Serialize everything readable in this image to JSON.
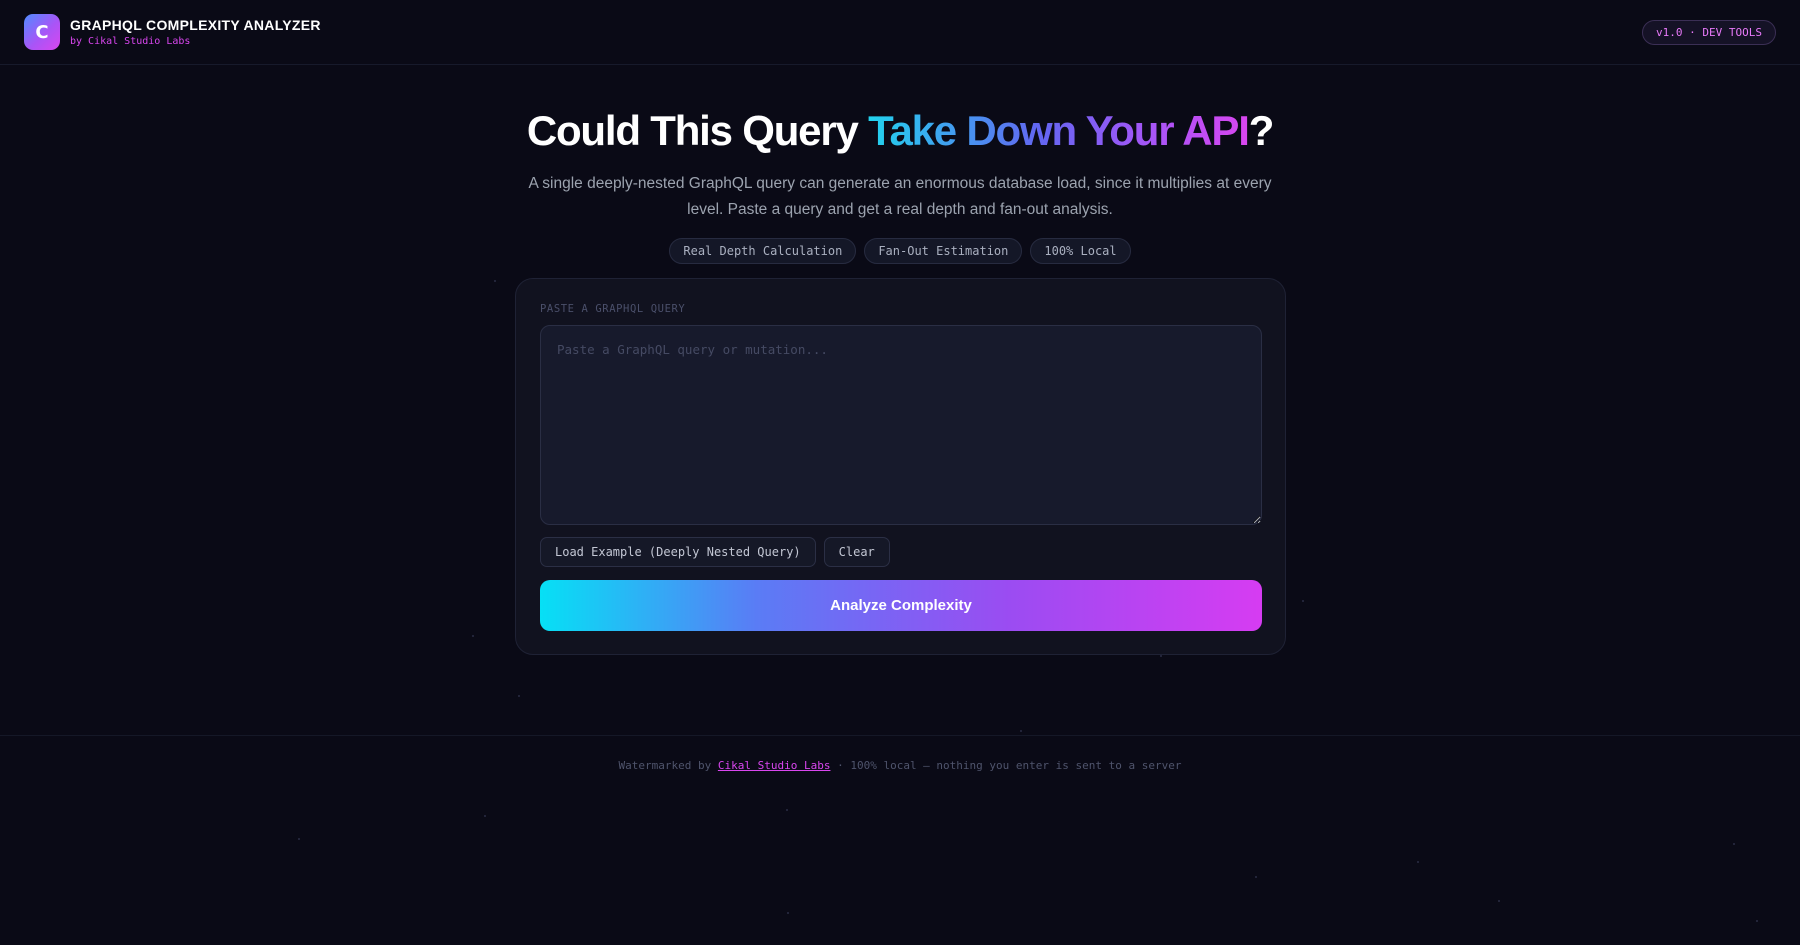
{
  "header": {
    "logo_letter": "C",
    "title": "GRAPHQL COMPLEXITY ANALYZER",
    "subtitle": "by Cikal Studio Labs",
    "version_badge": "v1.0 · DEV TOOLS"
  },
  "hero": {
    "title_lead": "Could This Query ",
    "title_accent": "Take Down Your API",
    "title_tail": "?",
    "description": "A single deeply-nested GraphQL query can generate an enormous database load, since it multiplies at every level. Paste a query and get a real depth and fan-out analysis.",
    "chips": [
      "Real Depth Calculation",
      "Fan-Out Estimation",
      "100% Local"
    ]
  },
  "card": {
    "label": "PASTE A GRAPHQL QUERY",
    "input_placeholder": "Paste a GraphQL query or mutation...",
    "input_value": "",
    "load_example_label": "Load Example (Deeply Nested Query)",
    "clear_label": "Clear",
    "analyze_label": "Analyze Complexity"
  },
  "footer": {
    "prefix": "Watermarked by ",
    "link_text": "Cikal Studio Labs",
    "suffix": " · 100% local — nothing you enter is sent to a server"
  },
  "colors": {
    "background": "#0a0a16",
    "accent_pink": "#d946ef",
    "accent_cyan": "#22d3ee",
    "accent_purple": "#a855f7"
  }
}
